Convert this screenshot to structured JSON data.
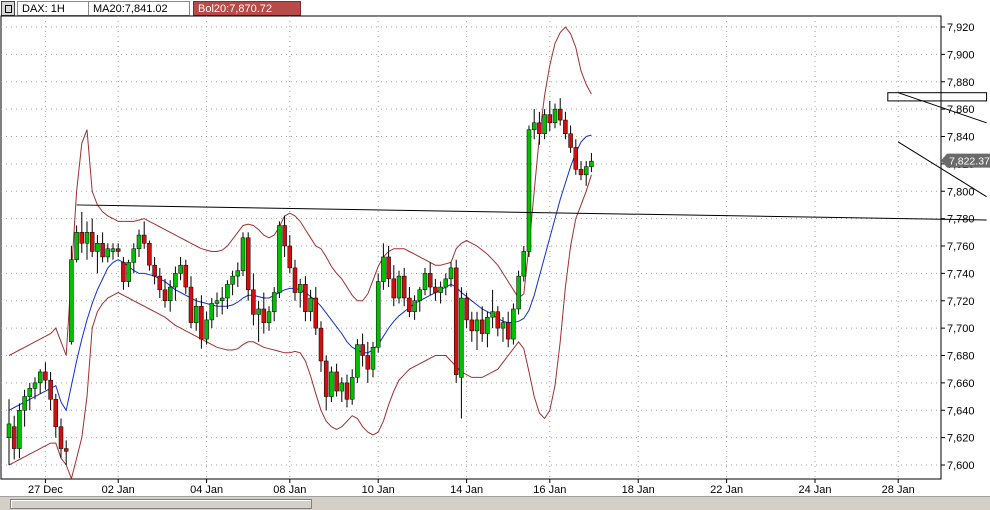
{
  "toolbar": {
    "symbol_label": "DAX: 1H",
    "ma_label": "MA20:7,841.02",
    "bol_label": "Bol20:7,870.72"
  },
  "colors": {
    "up": "#00c000",
    "down": "#d01010",
    "ma": "#1030d0",
    "bands": "#a03030",
    "trendline": "#000000",
    "grid": "#a0a0a0",
    "price_marker": "#6a6a6a"
  },
  "chart_data": {
    "type": "candlestick",
    "title": "",
    "instrument": "DAX",
    "timeframe": "1H",
    "ylim": [
      7595,
      7930
    ],
    "yticks": [
      7600,
      7620,
      7640,
      7660,
      7680,
      7700,
      7720,
      7740,
      7760,
      7780,
      7800,
      7820,
      7840,
      7860,
      7880,
      7900,
      7920
    ],
    "ytick_labels": [
      "7,600",
      "7,620",
      "7,640",
      "7,660",
      "7,680",
      "7,700",
      "7,720",
      "7,740",
      "7,760",
      "7,780",
      "7,800",
      "7,820",
      "7,840",
      "7,860",
      "7,880",
      "7,900",
      "7,920"
    ],
    "x_labels": [
      {
        "label": "27 Dec",
        "bar": 7
      },
      {
        "label": "02 Jan",
        "bar": 21
      },
      {
        "label": "04 Jan",
        "bar": 38
      },
      {
        "label": "08 Jan",
        "bar": 54
      },
      {
        "label": "10 Jan",
        "bar": 71
      },
      {
        "label": "14 Jan",
        "bar": 88
      },
      {
        "label": "16 Jan",
        "bar": 104
      },
      {
        "label": "18 Jan",
        "bar": 121
      },
      {
        "label": "22 Jan",
        "bar": 138
      },
      {
        "label": "24 Jan",
        "bar": 155
      },
      {
        "label": "28 Jan",
        "bar": 171
      }
    ],
    "last_price_label": "7,822.37",
    "last_price": 7822.37,
    "candles": [
      [
        7620,
        7648,
        7600,
        7630
      ],
      [
        7628,
        7636,
        7604,
        7612
      ],
      [
        7612,
        7645,
        7605,
        7640
      ],
      [
        7640,
        7655,
        7628,
        7650
      ],
      [
        7650,
        7660,
        7640,
        7656
      ],
      [
        7656,
        7664,
        7648,
        7660
      ],
      [
        7660,
        7670,
        7652,
        7668
      ],
      [
        7668,
        7675,
        7655,
        7662
      ],
      [
        7662,
        7668,
        7640,
        7648
      ],
      [
        7648,
        7652,
        7620,
        7628
      ],
      [
        7628,
        7634,
        7605,
        7612
      ],
      [
        7612,
        7618,
        7600,
        7610
      ],
      [
        7690,
        7760,
        7688,
        7750
      ],
      [
        7750,
        7775,
        7748,
        7770
      ],
      [
        7770,
        7785,
        7755,
        7762
      ],
      [
        7762,
        7778,
        7750,
        7770
      ],
      [
        7770,
        7780,
        7752,
        7756
      ],
      [
        7756,
        7768,
        7740,
        7762
      ],
      [
        7762,
        7770,
        7748,
        7752
      ],
      [
        7752,
        7762,
        7748,
        7758
      ],
      [
        7756,
        7762,
        7750,
        7758
      ],
      [
        7758,
        7762,
        7752,
        7756
      ],
      [
        7748,
        7752,
        7728,
        7734
      ],
      [
        7734,
        7750,
        7730,
        7748
      ],
      [
        7748,
        7762,
        7740,
        7758
      ],
      [
        7758,
        7772,
        7752,
        7768
      ],
      [
        7768,
        7778,
        7758,
        7762
      ],
      [
        7762,
        7764,
        7742,
        7746
      ],
      [
        7746,
        7752,
        7732,
        7738
      ],
      [
        7738,
        7744,
        7722,
        7728
      ],
      [
        7728,
        7736,
        7715,
        7720
      ],
      [
        7720,
        7735,
        7712,
        7730
      ],
      [
        7730,
        7745,
        7720,
        7740
      ],
      [
        7740,
        7752,
        7735,
        7746
      ],
      [
        7746,
        7750,
        7725,
        7730
      ],
      [
        7730,
        7738,
        7700,
        7704
      ],
      [
        7704,
        7722,
        7698,
        7716
      ],
      [
        7716,
        7724,
        7685,
        7692
      ],
      [
        7692,
        7712,
        7688,
        7706
      ],
      [
        7706,
        7722,
        7700,
        7718
      ],
      [
        7718,
        7726,
        7708,
        7720
      ],
      [
        7720,
        7730,
        7710,
        7722
      ],
      [
        7722,
        7735,
        7714,
        7732
      ],
      [
        7732,
        7742,
        7724,
        7738
      ],
      [
        7738,
        7748,
        7730,
        7742
      ],
      [
        7742,
        7770,
        7738,
        7766
      ],
      [
        7766,
        7770,
        7720,
        7728
      ],
      [
        7728,
        7740,
        7702,
        7710
      ],
      [
        7710,
        7720,
        7690,
        7714
      ],
      [
        7714,
        7726,
        7696,
        7704
      ],
      [
        7704,
        7716,
        7698,
        7712
      ],
      [
        7712,
        7730,
        7705,
        7726
      ],
      [
        7726,
        7778,
        7722,
        7775
      ],
      [
        7775,
        7782,
        7752,
        7760
      ],
      [
        7760,
        7768,
        7740,
        7744
      ],
      [
        7744,
        7750,
        7720,
        7726
      ],
      [
        7726,
        7736,
        7715,
        7732
      ],
      [
        7732,
        7738,
        7705,
        7712
      ],
      [
        7712,
        7728,
        7705,
        7722
      ],
      [
        7722,
        7730,
        7695,
        7700
      ],
      [
        7700,
        7705,
        7668,
        7676
      ],
      [
        7676,
        7680,
        7640,
        7650
      ],
      [
        7650,
        7672,
        7646,
        7668
      ],
      [
        7668,
        7674,
        7650,
        7654
      ],
      [
        7654,
        7664,
        7646,
        7660
      ],
      [
        7660,
        7666,
        7642,
        7648
      ],
      [
        7648,
        7670,
        7644,
        7664
      ],
      [
        7664,
        7692,
        7660,
        7688
      ],
      [
        7688,
        7696,
        7672,
        7680
      ],
      [
        7680,
        7690,
        7660,
        7670
      ],
      [
        7670,
        7690,
        7664,
        7686
      ],
      [
        7686,
        7740,
        7682,
        7734
      ],
      [
        7734,
        7762,
        7728,
        7752
      ],
      [
        7752,
        7760,
        7730,
        7736
      ],
      [
        7736,
        7746,
        7716,
        7722
      ],
      [
        7722,
        7742,
        7718,
        7738
      ],
      [
        7738,
        7744,
        7716,
        7722
      ],
      [
        7722,
        7730,
        7708,
        7712
      ],
      [
        7712,
        7724,
        7706,
        7720
      ],
      [
        7720,
        7730,
        7712,
        7728
      ],
      [
        7728,
        7744,
        7724,
        7740
      ],
      [
        7740,
        7748,
        7724,
        7730
      ],
      [
        7730,
        7736,
        7720,
        7726
      ],
      [
        7726,
        7734,
        7718,
        7730
      ],
      [
        7730,
        7740,
        7724,
        7736
      ],
      [
        7736,
        7748,
        7730,
        7744
      ],
      [
        7744,
        7750,
        7660,
        7666
      ],
      [
        7664,
        7730,
        7634,
        7722
      ],
      [
        7722,
        7726,
        7700,
        7706
      ],
      [
        7706,
        7712,
        7690,
        7698
      ],
      [
        7698,
        7712,
        7684,
        7706
      ],
      [
        7706,
        7716,
        7690,
        7696
      ],
      [
        7696,
        7712,
        7686,
        7708
      ],
      [
        7708,
        7728,
        7700,
        7712
      ],
      [
        7712,
        7716,
        7694,
        7700
      ],
      [
        7700,
        7708,
        7690,
        7704
      ],
      [
        7704,
        7712,
        7686,
        7692
      ],
      [
        7692,
        7718,
        7688,
        7714
      ],
      [
        7714,
        7742,
        7710,
        7738
      ],
      [
        7738,
        7760,
        7734,
        7756
      ],
      [
        7756,
        7848,
        7752,
        7845
      ],
      [
        7845,
        7860,
        7838,
        7850
      ],
      [
        7850,
        7858,
        7834,
        7842
      ],
      [
        7842,
        7860,
        7838,
        7856
      ],
      [
        7856,
        7866,
        7844,
        7850
      ],
      [
        7850,
        7864,
        7846,
        7860
      ],
      [
        7860,
        7868,
        7848,
        7852
      ],
      [
        7852,
        7858,
        7838,
        7842
      ],
      [
        7842,
        7848,
        7828,
        7832
      ],
      [
        7832,
        7838,
        7812,
        7816
      ],
      [
        7816,
        7822,
        7808,
        7812
      ],
      [
        7812,
        7822,
        7804,
        7818
      ],
      [
        7818,
        7828,
        7814,
        7822
      ]
    ],
    "ma20": [
      7640,
      7642,
      7644,
      7646,
      7648,
      7650,
      7652,
      7654,
      7656,
      7658,
      7646,
      7640,
      7658,
      7676,
      7692,
      7706,
      7718,
      7728,
      7736,
      7744,
      7748,
      7750,
      7748,
      7745,
      7742,
      7740,
      7740,
      7739,
      7738,
      7736,
      7734,
      7731,
      7728,
      7726,
      7724,
      7722,
      7720,
      7719,
      7718,
      7717,
      7716,
      7716,
      7716,
      7717,
      7719,
      7722,
      7724,
      7724,
      7723,
      7722,
      7722,
      7724,
      7726,
      7728,
      7729,
      7729,
      7728,
      7726,
      7723,
      7720,
      7716,
      7711,
      7706,
      7701,
      7696,
      7690,
      7686,
      7684,
      7682,
      7682,
      7684,
      7688,
      7694,
      7700,
      7705,
      7709,
      7712,
      7715,
      7718,
      7720,
      7722,
      7724,
      7726,
      7728,
      7730,
      7732,
      7730,
      7726,
      7723,
      7720,
      7717,
      7714,
      7712,
      7710,
      7707,
      7705,
      7704,
      7704,
      7705,
      7707,
      7713,
      7724,
      7738,
      7752,
      7766,
      7780,
      7794,
      7806,
      7818,
      7828,
      7836,
      7840,
      7841
    ],
    "bol_upper": [
      7680,
      7682,
      7684,
      7686,
      7688,
      7690,
      7692,
      7694,
      7696,
      7700,
      7690,
      7680,
      7740,
      7800,
      7835,
      7845,
      7800,
      7790,
      7785,
      7782,
      7780,
      7778,
      7778,
      7778,
      7778,
      7779,
      7780,
      7778,
      7776,
      7774,
      7772,
      7770,
      7768,
      7766,
      7764,
      7762,
      7760,
      7758,
      7757,
      7756,
      7756,
      7757,
      7760,
      7765,
      7770,
      7775,
      7776,
      7775,
      7772,
      7768,
      7766,
      7768,
      7774,
      7782,
      7784,
      7782,
      7778,
      7772,
      7766,
      7760,
      7758,
      7752,
      7745,
      7740,
      7736,
      7730,
      7724,
      7720,
      7720,
      7725,
      7735,
      7745,
      7752,
      7756,
      7758,
      7758,
      7758,
      7756,
      7754,
      7752,
      7750,
      7748,
      7746,
      7746,
      7747,
      7748,
      7758,
      7762,
      7764,
      7762,
      7760,
      7757,
      7754,
      7750,
      7746,
      7740,
      7734,
      7728,
      7722,
      7725,
      7760,
      7800,
      7840,
      7870,
      7892,
      7908,
      7916,
      7920,
      7915,
      7905,
      7888,
      7878,
      7871
    ],
    "bol_lower": [
      7600,
      7602,
      7604,
      7606,
      7608,
      7610,
      7612,
      7614,
      7616,
      7616,
      7605,
      7600,
      7590,
      7605,
      7620,
      7650,
      7700,
      7712,
      7718,
      7722,
      7724,
      7726,
      7724,
      7722,
      7720,
      7718,
      7716,
      7714,
      7712,
      7710,
      7708,
      7705,
      7702,
      7700,
      7698,
      7696,
      7694,
      7692,
      7690,
      7688,
      7686,
      7685,
      7684,
      7684,
      7685,
      7688,
      7690,
      7690,
      7688,
      7686,
      7685,
      7684,
      7683,
      7682,
      7682,
      7683,
      7682,
      7676,
      7665,
      7652,
      7640,
      7632,
      7628,
      7626,
      7628,
      7632,
      7636,
      7634,
      7628,
      7624,
      7622,
      7624,
      7632,
      7644,
      7654,
      7662,
      7666,
      7670,
      7672,
      7674,
      7676,
      7678,
      7680,
      7680,
      7680,
      7676,
      7672,
      7668,
      7666,
      7664,
      7664,
      7664,
      7666,
      7668,
      7670,
      7675,
      7680,
      7685,
      7690,
      7685,
      7668,
      7650,
      7638,
      7634,
      7640,
      7658,
      7690,
      7730,
      7760,
      7780,
      7790,
      7800,
      7812
    ],
    "annotations": [
      {
        "type": "trendline",
        "from": [
          13,
          7790
        ],
        "to": [
          188,
          7779
        ]
      },
      {
        "type": "channel_upper",
        "from": [
          171,
          7872
        ],
        "to": [
          188,
          7850
        ]
      },
      {
        "type": "channel_lower",
        "from": [
          171,
          7836
        ],
        "to": [
          188,
          7796
        ]
      },
      {
        "type": "range_box",
        "from": [
          169,
          7872
        ],
        "to": [
          188,
          7866
        ]
      }
    ]
  }
}
